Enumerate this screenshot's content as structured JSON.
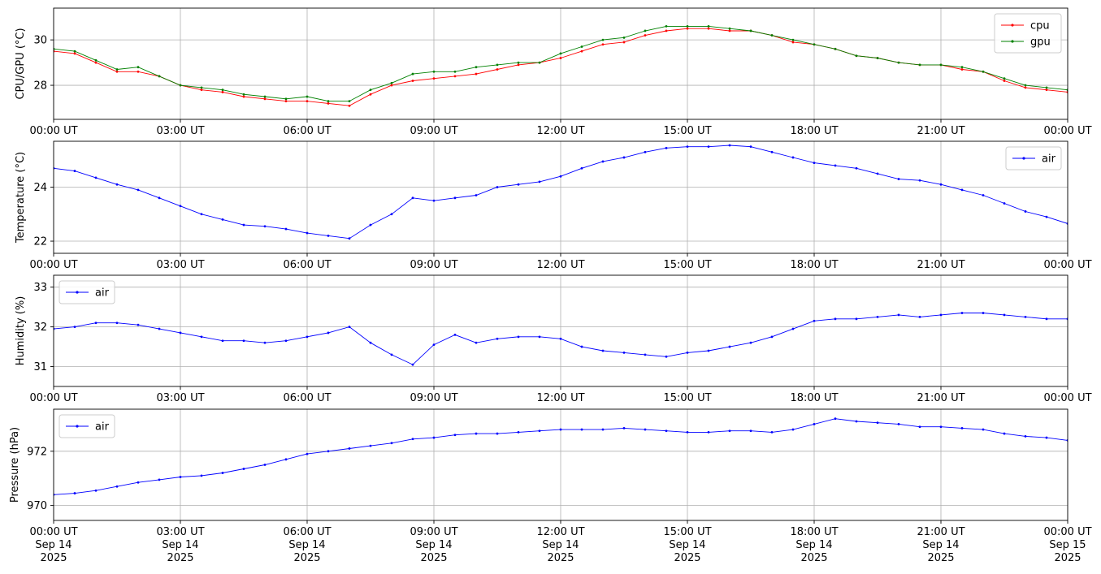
{
  "chart_data": [
    {
      "type": "line",
      "ylabel": "CPU/GPU (°C)",
      "ylim": [
        26.5,
        31.4
      ],
      "yticks": [
        28,
        30
      ],
      "xlim": [
        "2025-09-14T00:00",
        "2025-09-15T00:00"
      ],
      "xtick_labels": [
        "00:00 UT",
        "03:00 UT",
        "06:00 UT",
        "09:00 UT",
        "12:00 UT",
        "15:00 UT",
        "18:00 UT",
        "21:00 UT",
        "00:00 UT"
      ],
      "grid": true,
      "legend_position": "upper right",
      "series": [
        {
          "name": "cpu",
          "color": "#ff0000",
          "x_hours": [
            0,
            0.5,
            1,
            1.5,
            2,
            2.5,
            3,
            3.5,
            4,
            4.5,
            5,
            5.5,
            6,
            6.5,
            7,
            7.5,
            8,
            8.5,
            9,
            9.5,
            10,
            10.5,
            11,
            11.5,
            12,
            12.5,
            13,
            13.5,
            14,
            14.5,
            15,
            15.5,
            16,
            16.5,
            17,
            17.5,
            18,
            18.5,
            19,
            19.5,
            20,
            20.5,
            21,
            21.5,
            22,
            22.5,
            23,
            23.5,
            24
          ],
          "y": [
            29.5,
            29.4,
            29.0,
            28.6,
            28.6,
            28.4,
            28.0,
            27.8,
            27.7,
            27.5,
            27.4,
            27.3,
            27.3,
            27.2,
            27.1,
            27.6,
            28.0,
            28.2,
            28.3,
            28.4,
            28.5,
            28.7,
            28.9,
            29.0,
            29.2,
            29.5,
            29.8,
            29.9,
            30.2,
            30.4,
            30.5,
            30.5,
            30.4,
            30.4,
            30.2,
            29.9,
            29.8,
            29.6,
            29.3,
            29.2,
            29.0,
            28.9,
            28.9,
            28.7,
            28.6,
            28.2,
            27.9,
            27.8,
            27.7
          ]
        },
        {
          "name": "gpu",
          "color": "#008000",
          "x_hours": [
            0,
            0.5,
            1,
            1.5,
            2,
            2.5,
            3,
            3.5,
            4,
            4.5,
            5,
            5.5,
            6,
            6.5,
            7,
            7.5,
            8,
            8.5,
            9,
            9.5,
            10,
            10.5,
            11,
            11.5,
            12,
            12.5,
            13,
            13.5,
            14,
            14.5,
            15,
            15.5,
            16,
            16.5,
            17,
            17.5,
            18,
            18.5,
            19,
            19.5,
            20,
            20.5,
            21,
            21.5,
            22,
            22.5,
            23,
            23.5,
            24
          ],
          "y": [
            29.6,
            29.5,
            29.1,
            28.7,
            28.8,
            28.4,
            28.0,
            27.9,
            27.8,
            27.6,
            27.5,
            27.4,
            27.5,
            27.3,
            27.3,
            27.8,
            28.1,
            28.5,
            28.6,
            28.6,
            28.8,
            28.9,
            29.0,
            29.0,
            29.4,
            29.7,
            30.0,
            30.1,
            30.4,
            30.6,
            30.6,
            30.6,
            30.5,
            30.4,
            30.2,
            30.0,
            29.8,
            29.6,
            29.3,
            29.2,
            29.0,
            28.9,
            28.9,
            28.8,
            28.6,
            28.3,
            28.0,
            27.9,
            27.8
          ]
        }
      ]
    },
    {
      "type": "line",
      "ylabel": "Temperature (°C)",
      "ylim": [
        21.55,
        25.7
      ],
      "yticks": [
        22,
        24
      ],
      "xlim": [
        "2025-09-14T00:00",
        "2025-09-15T00:00"
      ],
      "xtick_labels": [
        "00:00 UT",
        "03:00 UT",
        "06:00 UT",
        "09:00 UT",
        "12:00 UT",
        "15:00 UT",
        "18:00 UT",
        "21:00 UT",
        "00:00 UT"
      ],
      "grid": true,
      "legend_position": "upper right",
      "series": [
        {
          "name": "air",
          "color": "#0000ff",
          "x_hours": [
            0,
            0.5,
            1,
            1.5,
            2,
            2.5,
            3,
            3.5,
            4,
            4.5,
            5,
            5.5,
            6,
            6.5,
            7,
            7.5,
            8,
            8.5,
            9,
            9.5,
            10,
            10.5,
            11,
            11.5,
            12,
            12.5,
            13,
            13.5,
            14,
            14.5,
            15,
            15.5,
            16,
            16.5,
            17,
            17.5,
            18,
            18.5,
            19,
            19.5,
            20,
            20.5,
            21,
            21.5,
            22,
            22.5,
            23,
            23.5,
            24
          ],
          "y": [
            24.7,
            24.6,
            24.35,
            24.1,
            23.9,
            23.6,
            23.3,
            23.0,
            22.8,
            22.6,
            22.55,
            22.45,
            22.3,
            22.2,
            22.1,
            22.6,
            23.0,
            23.6,
            23.5,
            23.6,
            23.7,
            24.0,
            24.1,
            24.2,
            24.4,
            24.7,
            24.95,
            25.1,
            25.3,
            25.45,
            25.5,
            25.5,
            25.55,
            25.5,
            25.3,
            25.1,
            24.9,
            24.8,
            24.7,
            24.5,
            24.3,
            24.25,
            24.1,
            23.9,
            23.7,
            23.4,
            23.1,
            22.9,
            22.65
          ]
        }
      ]
    },
    {
      "type": "line",
      "ylabel": "Humidity (%)",
      "ylim": [
        30.5,
        33.3
      ],
      "yticks": [
        31,
        32,
        33
      ],
      "xlim": [
        "2025-09-14T00:00",
        "2025-09-15T00:00"
      ],
      "xtick_labels": [
        "00:00 UT",
        "03:00 UT",
        "06:00 UT",
        "09:00 UT",
        "12:00 UT",
        "15:00 UT",
        "18:00 UT",
        "21:00 UT",
        "00:00 UT"
      ],
      "grid": true,
      "legend_position": "upper left",
      "series": [
        {
          "name": "air",
          "color": "#0000ff",
          "x_hours": [
            0,
            0.5,
            1,
            1.5,
            2,
            2.5,
            3,
            3.5,
            4,
            4.5,
            5,
            5.5,
            6,
            6.5,
            7,
            7.5,
            8,
            8.5,
            9,
            9.5,
            10,
            10.5,
            11,
            11.5,
            12,
            12.5,
            13,
            13.5,
            14,
            14.5,
            15,
            15.5,
            16,
            16.5,
            17,
            17.5,
            18,
            18.5,
            19,
            19.5,
            20,
            20.5,
            21,
            21.5,
            22,
            22.5,
            23,
            23.5,
            24
          ],
          "y": [
            31.95,
            32.0,
            32.1,
            32.1,
            32.05,
            31.95,
            31.85,
            31.75,
            31.65,
            31.65,
            31.6,
            31.65,
            31.75,
            31.85,
            32.0,
            31.6,
            31.3,
            31.05,
            31.55,
            31.8,
            31.6,
            31.7,
            31.75,
            31.75,
            31.7,
            31.5,
            31.4,
            31.35,
            31.3,
            31.25,
            31.35,
            31.4,
            31.5,
            31.6,
            31.75,
            31.95,
            32.15,
            32.2,
            32.2,
            32.25,
            32.3,
            32.25,
            32.3,
            32.35,
            32.35,
            32.3,
            32.25,
            32.2,
            32.2
          ]
        }
      ]
    },
    {
      "type": "line",
      "ylabel": "Pressure (hPa)",
      "ylim": [
        969.45,
        973.55
      ],
      "yticks": [
        970,
        972
      ],
      "xlim": [
        "2025-09-14T00:00",
        "2025-09-15T00:00"
      ],
      "xtick_labels": [
        "00:00 UT\nSep 14\n2025",
        "03:00 UT\nSep 14\n2025",
        "06:00 UT\nSep 14\n2025",
        "09:00 UT\nSep 14\n2025",
        "12:00 UT\nSep 14\n2025",
        "15:00 UT\nSep 14\n2025",
        "18:00 UT\nSep 14\n2025",
        "21:00 UT\nSep 14\n2025",
        "00:00 UT\nSep 15\n2025"
      ],
      "grid": true,
      "legend_position": "upper left",
      "series": [
        {
          "name": "air",
          "color": "#0000ff",
          "x_hours": [
            0,
            0.5,
            1,
            1.5,
            2,
            2.5,
            3,
            3.5,
            4,
            4.5,
            5,
            5.5,
            6,
            6.5,
            7,
            7.5,
            8,
            8.5,
            9,
            9.5,
            10,
            10.5,
            11,
            11.5,
            12,
            12.5,
            13,
            13.5,
            14,
            14.5,
            15,
            15.5,
            16,
            16.5,
            17,
            17.5,
            18,
            18.5,
            19,
            19.5,
            20,
            20.5,
            21,
            21.5,
            22,
            22.5,
            23,
            23.5,
            24
          ],
          "y": [
            970.4,
            970.45,
            970.55,
            970.7,
            970.85,
            970.95,
            971.05,
            971.1,
            971.2,
            971.35,
            971.5,
            971.7,
            971.9,
            972.0,
            972.1,
            972.2,
            972.3,
            972.45,
            972.5,
            972.6,
            972.65,
            972.65,
            972.7,
            972.75,
            972.8,
            972.8,
            972.8,
            972.85,
            972.8,
            972.75,
            972.7,
            972.7,
            972.75,
            972.75,
            972.7,
            972.8,
            973.0,
            973.2,
            973.1,
            973.05,
            973.0,
            972.9,
            972.9,
            972.85,
            972.8,
            972.65,
            972.55,
            972.5,
            972.4
          ]
        }
      ]
    }
  ]
}
